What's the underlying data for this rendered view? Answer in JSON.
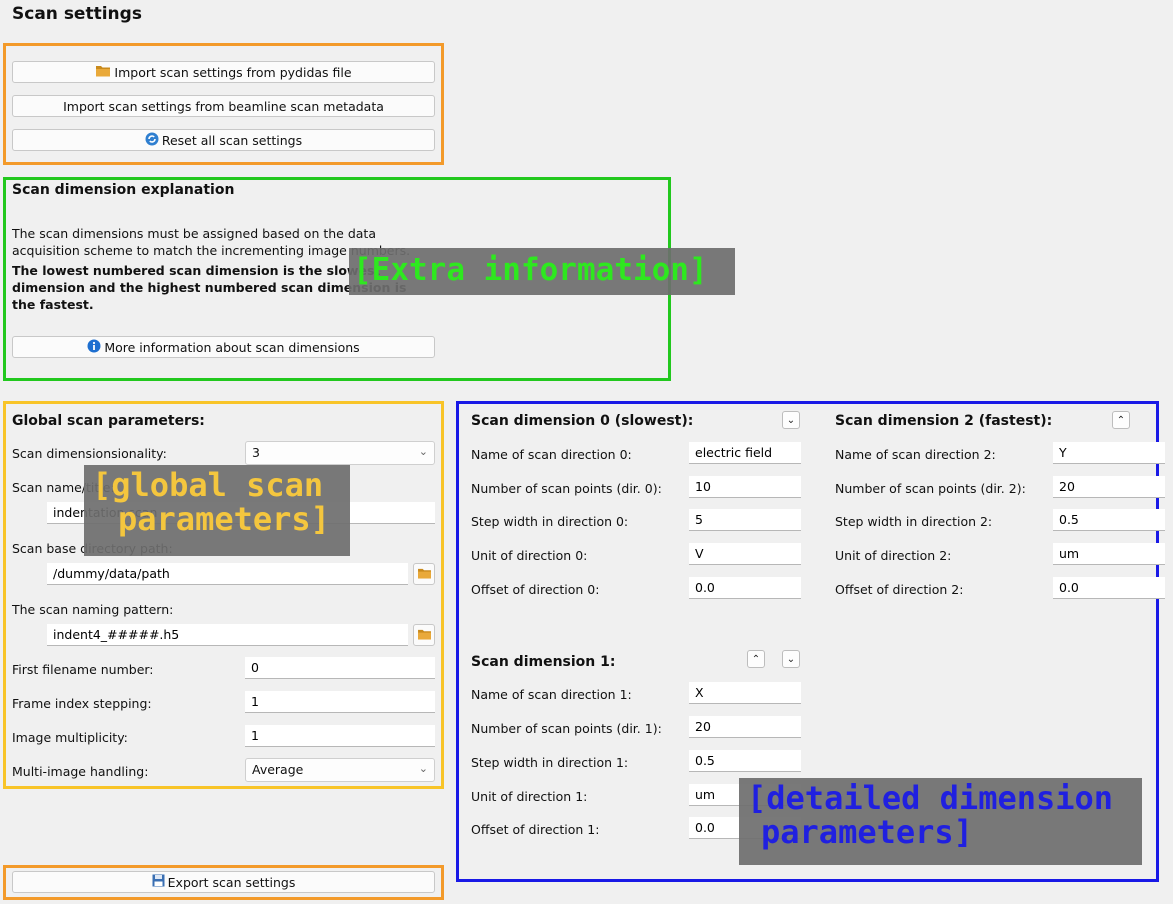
{
  "page": {
    "title": "Scan settings"
  },
  "colors": {
    "orange": "#f39a2a",
    "green": "#22c81e",
    "yellow": "#f8c428",
    "blue": "#1919e6",
    "overlay_green": "#2ee81f",
    "overlay_yellow": "#f4c63e",
    "overlay_blue": "#2020e0"
  },
  "top_buttons": {
    "import_pydidas": "Import scan settings from pydidas file",
    "import_beamline": "Import scan settings from beamline scan metadata",
    "reset": "Reset all scan settings"
  },
  "explanation": {
    "title": "Scan dimension explanation",
    "text": "The scan dimensions must be assigned based on the data acquisition scheme to match the incrementing image numbers.",
    "bold_text": "The lowest numbered scan dimension is the slowest dimension and the highest numbered scan dimension is the fastest.",
    "more_button": "More information about scan dimensions"
  },
  "global": {
    "title": "Global scan parameters:",
    "dimensionality_label": "Scan dimensionsionality:",
    "dimensionality_value": "3",
    "name_label": "Scan name/title:",
    "name_value": "indentation scan",
    "base_dir_label": "Scan base directory path:",
    "base_dir_value": "/dummy/data/path",
    "pattern_label": "The scan naming pattern:",
    "pattern_value": "indent4_#####.h5",
    "first_num_label": "First filename number:",
    "first_num_value": "0",
    "frame_step_label": "Frame index stepping:",
    "frame_step_value": "1",
    "multiplicity_label": "Image multiplicity:",
    "multiplicity_value": "1",
    "handling_label": "Multi-image handling:",
    "handling_value": "Average"
  },
  "dim0": {
    "title": "Scan dimension 0 (slowest):",
    "name_label": "Name of scan direction 0:",
    "name_value": "electric field",
    "points_label": "Number of scan points (dir. 0):",
    "points_value": "10",
    "step_label": "Step width in direction 0:",
    "step_value": "5",
    "unit_label": "Unit of direction 0:",
    "unit_value": "V",
    "offset_label": "Offset of direction 0:",
    "offset_value": "0.0"
  },
  "dim1": {
    "title": "Scan dimension 1:",
    "name_label": "Name of scan direction 1:",
    "name_value": "X",
    "points_label": "Number of scan points (dir. 1):",
    "points_value": "20",
    "step_label": "Step width in direction 1:",
    "step_value": "0.5",
    "unit_label": "Unit of direction 1:",
    "unit_value": "um",
    "offset_label": "Offset of direction 1:",
    "offset_value": "0.0"
  },
  "dim2": {
    "title": "Scan dimension 2 (fastest):",
    "name_label": "Name of scan direction 2:",
    "name_value": "Y",
    "points_label": "Number of scan points (dir. 2):",
    "points_value": "20",
    "step_label": "Step width in direction 2:",
    "step_value": "0.5",
    "unit_label": "Unit of direction 2:",
    "unit_value": "um",
    "offset_label": "Offset of direction 2:",
    "offset_value": "0.0"
  },
  "export_button": "Export scan settings",
  "annotations": {
    "extra": "[Extra information]",
    "global_1": "[global scan",
    "global_2": "parameters]",
    "detailed_1": "[detailed dimension",
    "detailed_2": "parameters]"
  }
}
